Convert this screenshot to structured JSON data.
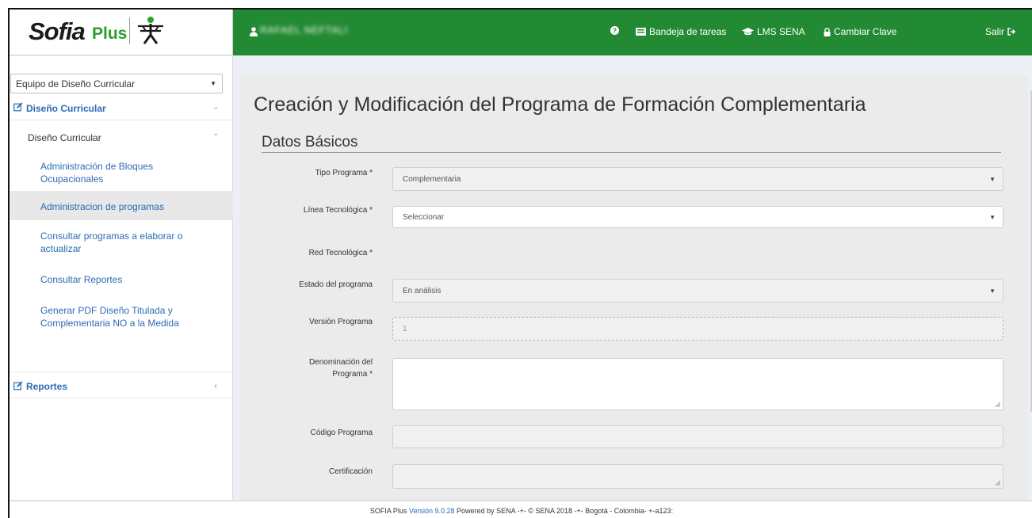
{
  "header": {
    "logo_main": "Sofia",
    "logo_plus": "Plus",
    "user_name": "RAFAEL NEFTALI",
    "nav": [
      {
        "label": "",
        "icon": "help-icon"
      },
      {
        "label": "Bandeja de tareas",
        "icon": "inbox-icon"
      },
      {
        "label": "LMS SENA",
        "icon": "graduation-cap-icon"
      },
      {
        "label": "Cambiar Clave",
        "icon": "lock-icon"
      },
      {
        "label": "Salir",
        "icon": "sign-out-icon"
      }
    ],
    "brand_color": "#238a34"
  },
  "sidebar": {
    "team_select": "Equipo de Diseño Curricular",
    "menu_diseno": "Diseño Curricular",
    "submenu_diseno": "Diseño Curricular",
    "items": [
      {
        "label": "Administración de Bloques Ocupacionales"
      },
      {
        "label": "Administracion de programas"
      },
      {
        "label": "Consultar programas a elaborar o actualizar"
      },
      {
        "label": "Consultar Reportes"
      },
      {
        "label": "Generar PDF Diseño Titulada y Complementaria NO a la Medida"
      }
    ],
    "menu_reportes": "Reportes"
  },
  "main": {
    "title": "Creación y Modificación del Programa de Formación Complementaria",
    "section": "Datos Básicos",
    "fields": {
      "tipo_programa": {
        "label": "Tipo Programa *",
        "value": "Complementaria"
      },
      "linea": {
        "label": "Línea Tecnológica *",
        "value": "Seleccionar"
      },
      "red": {
        "label": "Red Tecnológica *"
      },
      "estado": {
        "label": "Estado del programa",
        "value": "En análisis"
      },
      "version": {
        "label": "Versión Programa",
        "value": "1"
      },
      "denominacion": {
        "label_1": "Denominación del",
        "label_2": "Programa *",
        "value": ""
      },
      "codigo": {
        "label": "Código Programa",
        "value": ""
      },
      "certificacion": {
        "label": "Certificación",
        "value": ""
      }
    }
  },
  "footer": {
    "prefix": "SOFIA Plus",
    "version_text": "Versión",
    "version_number": "9.0.28",
    "suffix": "Powered by SENA -+- © SENA 2018 -+- Bogotá - Colombia- +-a123:"
  }
}
